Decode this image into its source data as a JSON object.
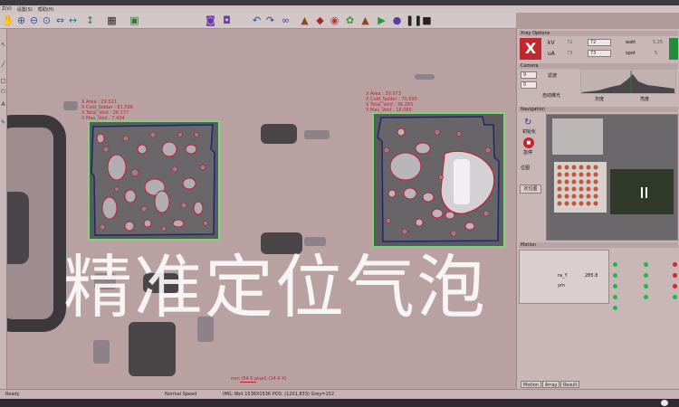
{
  "menu": {
    "items": [
      "Z(V)",
      "设置(S)",
      "帮助(H)"
    ]
  },
  "annotations": {
    "left": [
      "X Area : 29.521",
      "X Cold_Solder : 81.596",
      "X Total_Void : 28.177",
      "X Max_Void : 7.434"
    ],
    "right": [
      "X Area : 30.073",
      "X Cold_Solder : 70.595",
      "X Total_Void : 36.283",
      "X Max_Void : 18.060"
    ]
  },
  "watermark": "精准定位气泡",
  "scale": {
    "text": "mm (54.5 pixel) (14.4 X)"
  },
  "status": {
    "ready": "Ready",
    "mode": "Normal Speed",
    "img": "IMG: 8bit 1536X1536  POS: (1201,833) Grey=152"
  },
  "xray": {
    "title": "Xray Options",
    "kv_label": "kV",
    "ua_label": "uA",
    "kv_set": "72",
    "kv_actual": "72",
    "ua_set": "73",
    "ua_actual": "73",
    "watt_label": "watt",
    "watt_value": "5.25",
    "spot_label": "spot",
    "spot_value": "5"
  },
  "camera": {
    "title": "Camera",
    "gain": "9",
    "offset": "0",
    "filter_label": "滤波",
    "auto_exposure": "自动曝光",
    "gray_label": "灰度",
    "bright_label": "亮度"
  },
  "navigation": {
    "title": "Navigation",
    "init": "初始化",
    "stop": "急停",
    "pos_check": "位图",
    "locate": "定位图"
  },
  "motion": {
    "title": "Motion",
    "axis_label": "ra_Y",
    "axis_value": "285.8",
    "mm_label": "ym",
    "colors": {
      "green": "#23b84a",
      "red": "#d02a2a"
    }
  },
  "tabs": [
    "Motion",
    "Array",
    "Result"
  ]
}
